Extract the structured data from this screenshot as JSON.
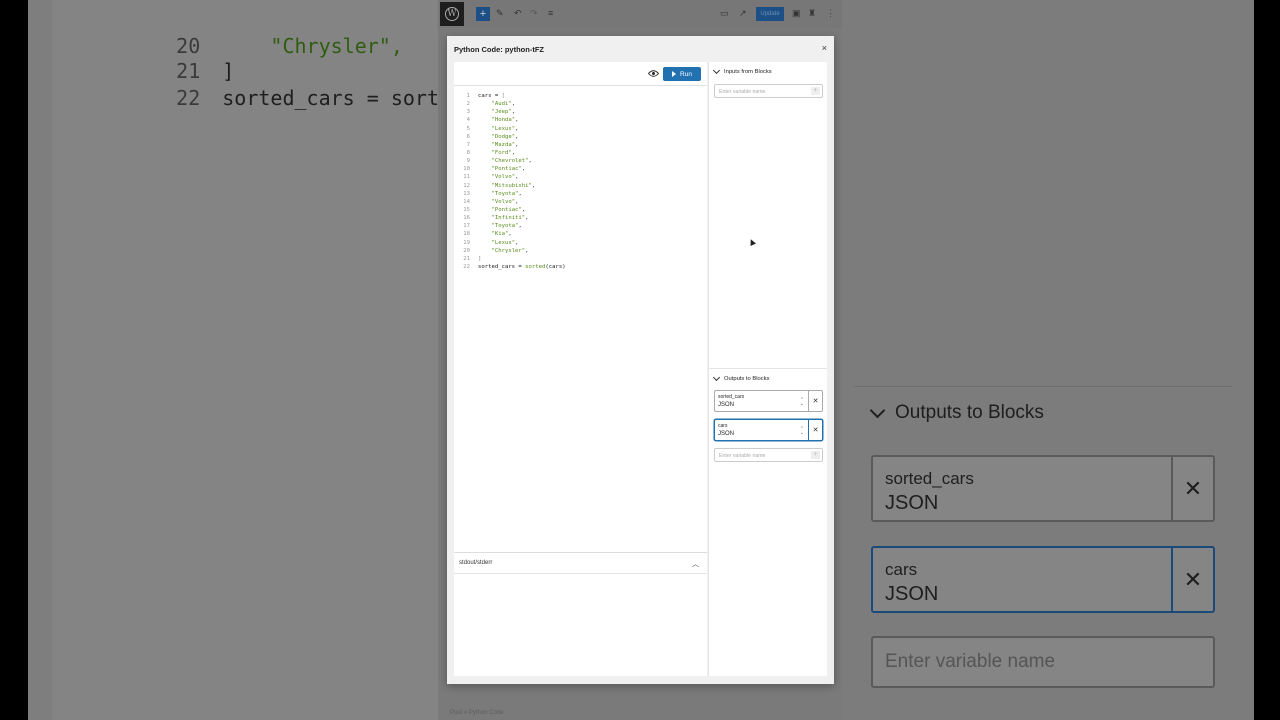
{
  "background_left": {
    "lines": [
      {
        "num": "20",
        "text": "\"Chrysler\","
      },
      {
        "num": "21",
        "text": "]"
      },
      {
        "num": "22",
        "text": "sorted_cars = sorted(cars)"
      }
    ]
  },
  "background_right": {
    "section_title": "Outputs to Blocks",
    "fields": [
      {
        "name": "sorted_cars",
        "type": "JSON"
      },
      {
        "name": "cars",
        "type": "JSON"
      }
    ],
    "input_placeholder": "Enter variable name"
  },
  "topbar": {
    "update_label": "Update",
    "breadcrumb": "Post  >  Python Code"
  },
  "modal": {
    "title": "Python Code: python-tFZ",
    "close_glyph": "×",
    "run_label": "Run",
    "output_title": "stdout/stderr",
    "inputs_section": "Inputs from Blocks",
    "outputs_section": "Outputs to Blocks",
    "input_placeholder": "Enter variable name",
    "outputs": [
      {
        "name": "sorted_cars",
        "type": "JSON"
      },
      {
        "name": "cars",
        "type": "JSON"
      }
    ],
    "output_placeholder": "Enter variable name",
    "code": [
      {
        "n": "1",
        "t": "cars = ["
      },
      {
        "n": "2",
        "t": "    \"Audi\","
      },
      {
        "n": "3",
        "t": "    \"Jeep\","
      },
      {
        "n": "4",
        "t": "    \"Honda\","
      },
      {
        "n": "5",
        "t": "    \"Lexus\","
      },
      {
        "n": "6",
        "t": "    \"Dodge\","
      },
      {
        "n": "7",
        "t": "    \"Mazda\","
      },
      {
        "n": "8",
        "t": "    \"Ford\","
      },
      {
        "n": "9",
        "t": "    \"Chevrolet\","
      },
      {
        "n": "10",
        "t": "    \"Pontiac\","
      },
      {
        "n": "11",
        "t": "    \"Volvo\","
      },
      {
        "n": "12",
        "t": "    \"Mitsubishi\","
      },
      {
        "n": "13",
        "t": "    \"Toyota\","
      },
      {
        "n": "14",
        "t": "    \"Volvo\","
      },
      {
        "n": "15",
        "t": "    \"Pontiac\","
      },
      {
        "n": "16",
        "t": "    \"Infiniti\","
      },
      {
        "n": "17",
        "t": "    \"Toyota\","
      },
      {
        "n": "18",
        "t": "    \"Kia\","
      },
      {
        "n": "19",
        "t": "    \"Lexus\","
      },
      {
        "n": "20",
        "t": "    \"Chrysler\","
      },
      {
        "n": "21",
        "t": "]"
      },
      {
        "n": "22",
        "t": "sorted_cars = sorted(cars)"
      }
    ]
  },
  "colors": {
    "accent": "#2271b1",
    "string": "#5a8a1a"
  },
  "icons": {
    "eye": "eye-icon",
    "play": "play-icon",
    "chevron": "chevron-down-icon",
    "close": "close-icon",
    "plus": "plus-icon",
    "updown": "select-arrows-icon"
  }
}
